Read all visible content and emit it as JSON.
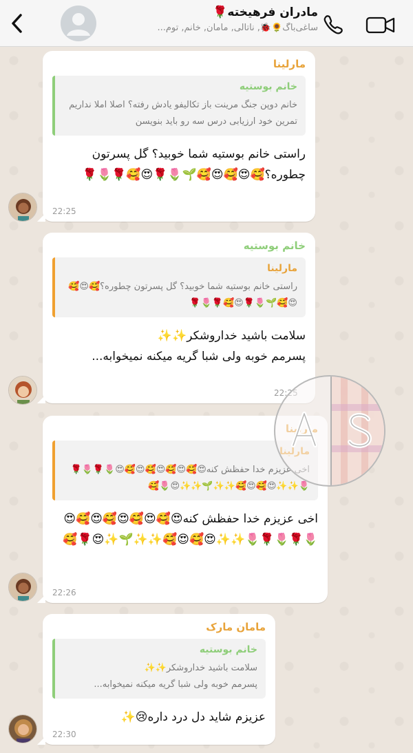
{
  "header": {
    "title": "مادران فرهیخته🌹",
    "subtitle": "ساغی‌باگ🌻🐞, ناتالی, مامان, خانم, توم..."
  },
  "messages": [
    {
      "sender": "مارلینا",
      "quote_sender": "خانم بوستیه",
      "quote_text": "خانم دوپن جنگ مرینت باز تکالیفو یادش رفته؟ اصلا املا نداریم تمرین خود ارزیابی درس سه رو باید بنویسن",
      "text": "راستی خانم بوستیه شما خوبید؟ گل پسرتون چطوره؟🥰😍🥰😍🥰🌱🌷🌹😍🥰🌹🌷🌹",
      "time": "22:25"
    },
    {
      "sender": "خانم بوستیه",
      "quote_sender": "مارلینا",
      "quote_text": "راستی خانم بوستیه شما خوبید؟ گل پسرتون چطوره؟🥰😍🥰😍🥰🌱🌷🌹😍🥰🌹🌷🌹",
      "text_line1": "سلامت باشید خداروشکر✨✨",
      "text_line2": "پسرمم خوبه ولی شبا گریه میکنه نمیخوابه...",
      "time": "22:25"
    },
    {
      "sender": "مارلینا",
      "quote_sender": "مارلینا",
      "quote_text": "اخی عزیزم خدا حفظش کنه😍🥰😍🥰😍🥰😍🥰😍🌷🌹🌷🌹🌷✨✨😍🥰😍🥰✨✨🌱✨✨😍🌷🥰",
      "text": "اخی عزیزم خدا حفظش کنه😍🥰😍🥰😍🥰😍🥰😍🌷🌹🌷🌹🌷✨✨😍🥰😍🥰✨✨🌱✨😍🌹🥰",
      "time": "22:26"
    },
    {
      "sender": "مامان مارک",
      "quote_sender": "خانم بوستیه",
      "quote_text_line1": "سلامت باشید خداروشکر✨✨",
      "quote_text_line2": "پسرمم خوبه ولی شبا گریه میکنه نمیخوابه...",
      "text": "عزیزم شاید دل درد داره😢✨",
      "time": "22:30"
    }
  ],
  "colors": {
    "marlina": "#e8a33a",
    "bustier": "#8fce7a",
    "mark_mom": "#e8a33a"
  }
}
